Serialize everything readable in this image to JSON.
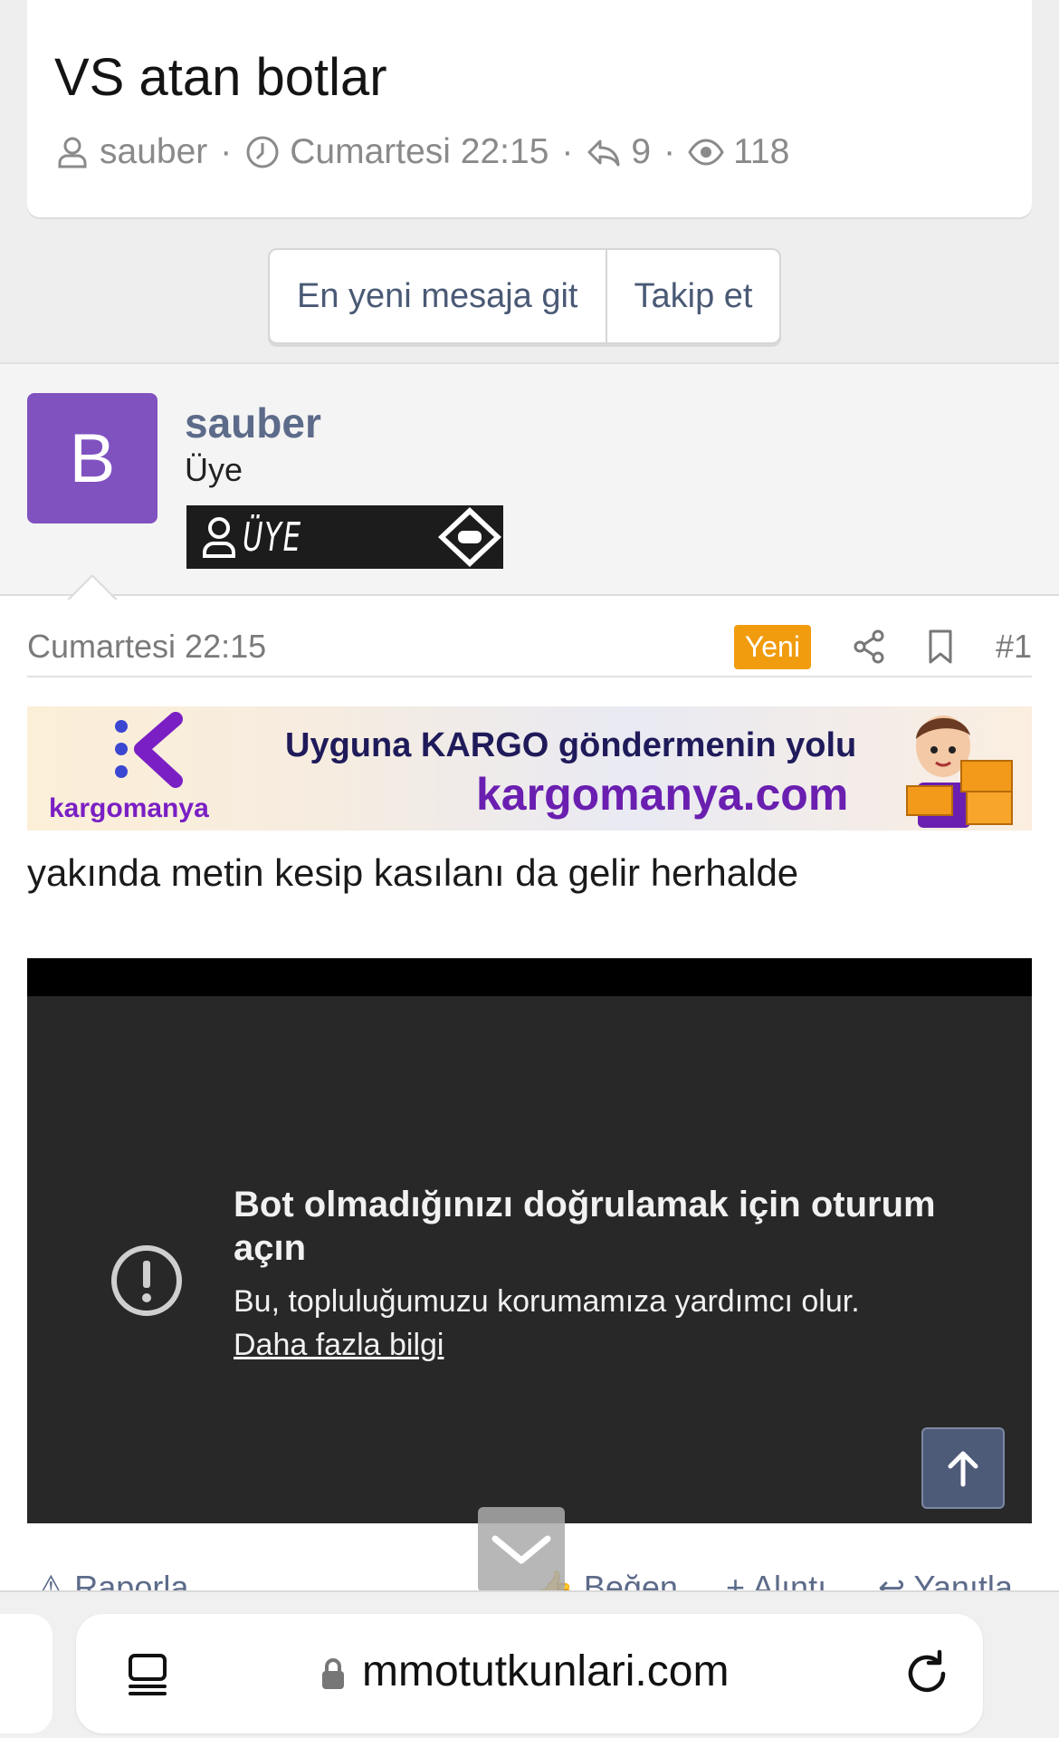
{
  "thread": {
    "title": "VS atan botlar",
    "author": "sauber",
    "date": "Cumartesi 22:15",
    "replies": "9",
    "views": "118"
  },
  "actions": {
    "latest": "En yeni mesaja git",
    "follow": "Takip et"
  },
  "post": {
    "avatar_letter": "B",
    "username": "sauber",
    "role": "Üye",
    "badge": "ÜYE",
    "date": "Cumartesi 22:15",
    "new_badge": "Yeni",
    "number": "#1",
    "body": "yakında metin kesip kasılanı da gelir herhalde"
  },
  "banner": {
    "brand": "kargomanya",
    "tagline": "Uyguna KARGO göndermenin yolu",
    "domain": "kargomanya.com"
  },
  "video": {
    "title": "Bot olmadığınızı doğrulamak için oturum açın",
    "subtitle": "Bu, topluluğumuzu korumamıza yardımcı olur.",
    "link": "Daha fazla bilgi"
  },
  "post_actions": {
    "report": "Raporla",
    "like": "Beğen",
    "quote": "Alıntı",
    "reply": "Yanıtla"
  },
  "browser": {
    "url": "mmotutkunlari.com"
  },
  "colors": {
    "accent": "#5d6b8a",
    "avatar": "#8052c0",
    "new_badge": "#f19c0f"
  }
}
